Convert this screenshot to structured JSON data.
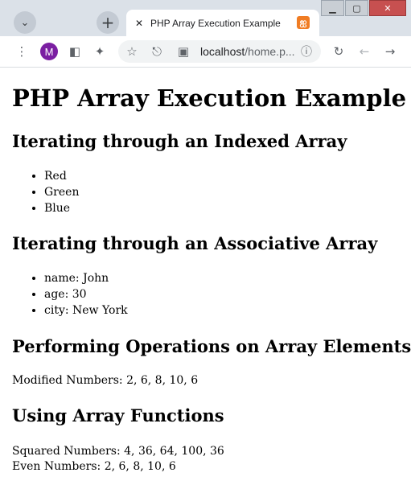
{
  "browser": {
    "tab_title": "PHP Array Execution Example",
    "avatar_letter": "M",
    "url_host": "localhost",
    "url_rest": "/home.p...",
    "accent_color": "#f07c23"
  },
  "page": {
    "title": "PHP Array Execution Example",
    "indexed": {
      "heading": "Iterating through an Indexed Array",
      "items": [
        "Red",
        "Green",
        "Blue"
      ]
    },
    "associative": {
      "heading": "Iterating through an Associative Array",
      "items": [
        "name: John",
        "age: 30",
        "city: New York"
      ]
    },
    "operations": {
      "heading": "Performing Operations on Array Elements",
      "modified": "Modified Numbers: 2, 6, 8, 10, 6"
    },
    "functions": {
      "heading": "Using Array Functions",
      "squared": "Squared Numbers: 4, 36, 64, 100, 36",
      "even": "Even Numbers: 2, 6, 8, 10, 6"
    }
  }
}
